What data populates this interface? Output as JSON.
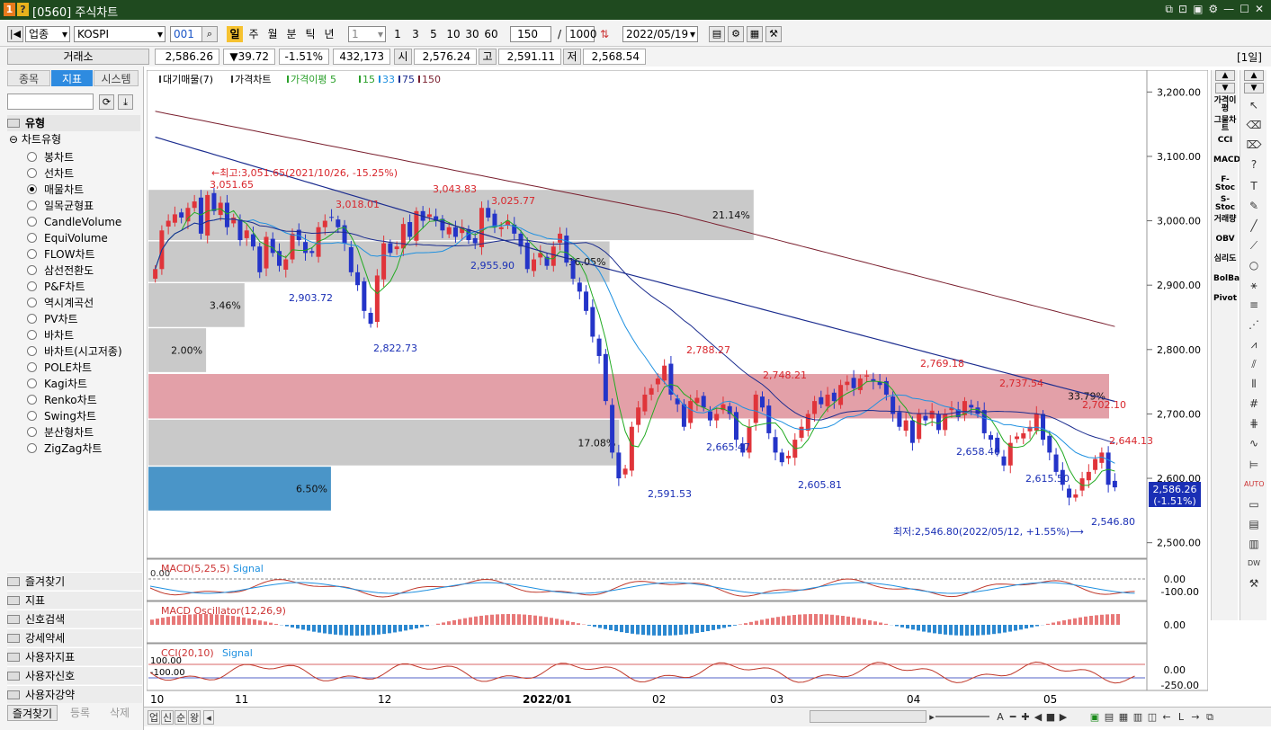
{
  "window": {
    "title": "[0560] 주식차트",
    "badge1": "1",
    "badge2": "?"
  },
  "toolbar": {
    "market_type": "업종",
    "index_name": "KOSPI",
    "code": "001",
    "periods": [
      "일",
      "주",
      "월",
      "분",
      "틱",
      "년"
    ],
    "interval": "1",
    "intervals": [
      "1",
      "3",
      "5",
      "10",
      "30",
      "60"
    ],
    "count": "150",
    "slash": "/",
    "total": "1000",
    "date": "2022/05/19"
  },
  "quote": {
    "exchange": "거래소",
    "price": "2,586.26",
    "change": "▼39.72",
    "change_pct": "-1.51%",
    "volume": "432,173",
    "open_label": "시",
    "open": "2,576.24",
    "high_label": "고",
    "high": "2,591.11",
    "low_label": "저",
    "low": "2,568.54",
    "period_badge": "[1일]"
  },
  "left_panel": {
    "tabs": [
      "종목",
      "지표",
      "시스템"
    ],
    "active_tab": "지표",
    "section": "유형",
    "tree_root": "차트유형",
    "chart_types": [
      "봉차트",
      "선차트",
      "매물차트",
      "일목균형표",
      "CandleVolume",
      "EquiVolume",
      "FLOW차트",
      "삼선전환도",
      "P&F차트",
      "역시계곡선",
      "PV차트",
      "바차트",
      "바차트(시고저종)",
      "POLE차트",
      "Kagi차트",
      "Renko차트",
      "Swing차트",
      "분산형차트",
      "ZigZag차트"
    ],
    "selected": "매물차트",
    "menus": [
      "즐겨찾기",
      "지표",
      "신호검색",
      "강세약세",
      "사용자지표",
      "사용자신호",
      "사용자강약"
    ],
    "bottom_buttons": [
      "즐겨찾기",
      "등록",
      "삭제"
    ]
  },
  "chart_data": {
    "type": "candlestick",
    "legend": [
      "대기매물(7)",
      "가격차트",
      "가격이평 5",
      "15",
      "33",
      "75",
      "150"
    ],
    "y_ticks": [
      "3,200.00",
      "3,100.00",
      "3,000.00",
      "2,900.00",
      "2,800.00",
      "2,700.00",
      "2,600.00",
      "2,500.00"
    ],
    "ylim": [
      2480,
      3220
    ],
    "x_labels": [
      "10",
      "11",
      "12",
      "2022/01",
      "02",
      "03",
      "04",
      "05"
    ],
    "last_price_tag": [
      "2,586.26",
      "(-1.51%)"
    ],
    "annotations_high": [
      {
        "label": "←최고:3,051.65(2021/10/26, -15.25%)"
      },
      {
        "label": "3,051.65"
      },
      {
        "label": "3,018.01"
      },
      {
        "label": "3,043.83"
      },
      {
        "label": "3,025.77"
      },
      {
        "label": "2,788.27"
      },
      {
        "label": "2,748.21"
      },
      {
        "label": "2,769.18"
      },
      {
        "label": "2,737.54"
      },
      {
        "label": "2,702.10"
      },
      {
        "label": "2,644.13"
      }
    ],
    "annotations_low": [
      {
        "label": "2,903.72"
      },
      {
        "label": "2,822.73"
      },
      {
        "label": "2,955.90"
      },
      {
        "label": "2,591.53"
      },
      {
        "label": "2,665.47"
      },
      {
        "label": "2,605.81"
      },
      {
        "label": "2,658.40"
      },
      {
        "label": "2,615.50"
      },
      {
        "label": "2,546.80"
      },
      {
        "label": "최저:2,546.80(2022/05/12, +1.55%)⟶"
      }
    ],
    "volume_profile": [
      {
        "pct": "21.14%",
        "lo": 2970,
        "hi": 3048,
        "len": 0.63
      },
      {
        "pct": "16.05%",
        "lo": 2905,
        "hi": 2968,
        "len": 0.48
      },
      {
        "pct": "3.46%",
        "lo": 2835,
        "hi": 2903,
        "len": 0.1
      },
      {
        "pct": "2.00%",
        "lo": 2765,
        "hi": 2833,
        "len": 0.06
      },
      {
        "pct": "33.79%",
        "lo": 2693,
        "hi": 2762,
        "len": 1.0,
        "highlight": true
      },
      {
        "pct": "17.08%",
        "lo": 2620,
        "hi": 2691,
        "len": 0.49
      },
      {
        "pct": "6.50%",
        "lo": 2550,
        "hi": 2618,
        "len": 0.19,
        "current": true
      }
    ],
    "closes": [
      2925,
      2985,
      3000,
      3010,
      3005,
      3020,
      3030,
      2980,
      3040,
      3015,
      3028,
      2990,
      3005,
      2970,
      2985,
      2960,
      2920,
      2975,
      2950,
      2930,
      2940,
      2980,
      2970,
      2950,
      2950,
      2990,
      3000,
      3005,
      2990,
      2965,
      2920,
      2900,
      2860,
      2840,
      2915,
      2965,
      2950,
      2960,
      2995,
      2975,
      3015,
      3000,
      3010,
      3000,
      2985,
      2990,
      2975,
      2990,
      2970,
      2965,
      3020,
      3005,
      2990,
      2990,
      3000,
      2980,
      2960,
      2925,
      2940,
      2950,
      2930,
      2960,
      2980,
      2935,
      2910,
      2890,
      2860,
      2820,
      2790,
      2720,
      2640,
      2600,
      2615,
      2680,
      2710,
      2730,
      2740,
      2755,
      2775,
      2730,
      2715,
      2680,
      2720,
      2725,
      2710,
      2690,
      2700,
      2715,
      2700,
      2660,
      2640,
      2680,
      2730,
      2710,
      2670,
      2640,
      2625,
      2635,
      2660,
      2680,
      2700,
      2720,
      2715,
      2730,
      2720,
      2745,
      2750,
      2740,
      2755,
      2760,
      2750,
      2745,
      2730,
      2700,
      2680,
      2690,
      2655,
      2700,
      2690,
      2705,
      2675,
      2700,
      2710,
      2695,
      2720,
      2710,
      2700,
      2670,
      2660,
      2640,
      2620,
      2655,
      2665,
      2670,
      2680,
      2700,
      2660,
      2640,
      2610,
      2590,
      2570,
      2575,
      2600,
      2610,
      2630,
      2640,
      2590,
      2586
    ],
    "macd": {
      "title": "MACD(5,25,5)",
      "signal": "Signal",
      "ticks": [
        "0.00",
        "-100.00"
      ],
      "top_label": "0.00"
    },
    "osc": {
      "title": "MACD Oscillator(12,26,9)",
      "ticks": [
        "0.00"
      ]
    },
    "cci": {
      "title": "CCI(20,10)",
      "signal": "Signal",
      "ticks": [
        "0.00",
        "-250.00"
      ],
      "top_labels": [
        "100.00",
        "-100.00"
      ]
    }
  },
  "right_indicators": [
    "가격이평",
    "그물차트",
    "CCI",
    "MACD",
    "F-Stoc",
    "S-Stoc",
    "거래량",
    "OBV",
    "심리도",
    "BolBand",
    "Pivot"
  ],
  "bottom_tabs": [
    "업",
    "신",
    "순",
    "왕"
  ]
}
